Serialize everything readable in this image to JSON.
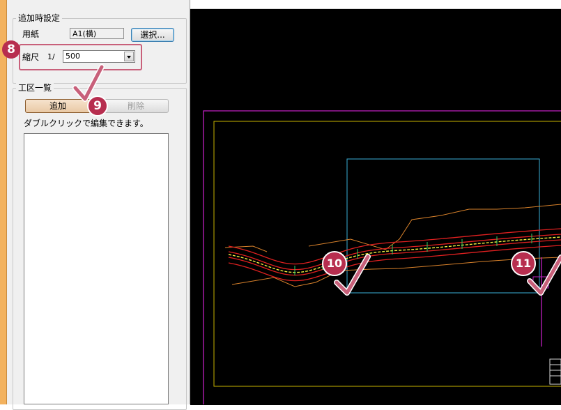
{
  "add_settings": {
    "legend": "追加時設定",
    "paper_label": "用紙",
    "paper_value": "A1(横)",
    "select_button": "選択...",
    "scale_label": "縮尺",
    "scale_prefix": "1/",
    "scale_value": "500"
  },
  "work_area_list": {
    "legend": "工区一覧",
    "add_button": "追加",
    "delete_button": "削除",
    "hint": "ダブルクリックで編集できます。"
  },
  "callouts": {
    "step8": "8",
    "step9": "9",
    "step10": "10",
    "step11": "11"
  },
  "colors": {
    "callout": "#b72e4f",
    "checkmark": "#c8607a",
    "cad_background": "#000000",
    "sheet_outline": "#c020c0",
    "inner_frame": "#c8b400",
    "work_area_rect": "#3ab0d8"
  },
  "icons": {
    "dropdown": "chevron-down-icon",
    "checkmark": "checkmark-icon"
  }
}
